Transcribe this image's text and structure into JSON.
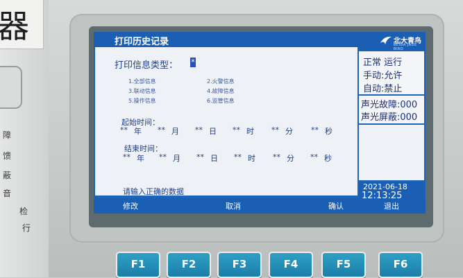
{
  "sticker": {
    "text": "器"
  },
  "side_labels": [
    "障",
    "馈",
    "蔽",
    "音",
    "检",
    "行"
  ],
  "window": {
    "title": "打印历史记录"
  },
  "brand": {
    "name": "北大青鸟",
    "sub": "BEIDA JADE BIRD"
  },
  "form": {
    "type_label": "打印信息类型：",
    "type_value": "*",
    "options": [
      "1.全部信息",
      "2.火警信息",
      "3.联动信息",
      "4.故障信息",
      "5.操作信息",
      "6.监管信息"
    ],
    "start_label": "起始时间：",
    "end_label": "结束时间：",
    "start_fields": [
      "**",
      "年",
      "**",
      "月",
      "**",
      "日",
      "**",
      "时",
      "**",
      "分",
      "**",
      "秒"
    ],
    "end_fields": [
      "**",
      "年",
      "**",
      "月",
      "**",
      "日",
      "**",
      "时",
      "**",
      "分",
      "**",
      "秒"
    ],
    "prompt": "请输入正确的数据"
  },
  "status": {
    "line1": "正常 运行",
    "line2": "手动:允许",
    "line3": "自动:禁止",
    "line4": "声光故障:000",
    "line5": "声光屏蔽:000",
    "date": "2021-06-18",
    "time": "12:13:25"
  },
  "softkeys": {
    "modify": "修改",
    "cancel": "取消",
    "confirm": "确认",
    "exit": "退出"
  },
  "fkeys": [
    "F1",
    "F2",
    "F3",
    "F4",
    "F5",
    "F6"
  ],
  "colors": {
    "screen_blue": "#1a5fb4",
    "panel": "#eef2f6",
    "key_blue": "#1b7ea8"
  }
}
